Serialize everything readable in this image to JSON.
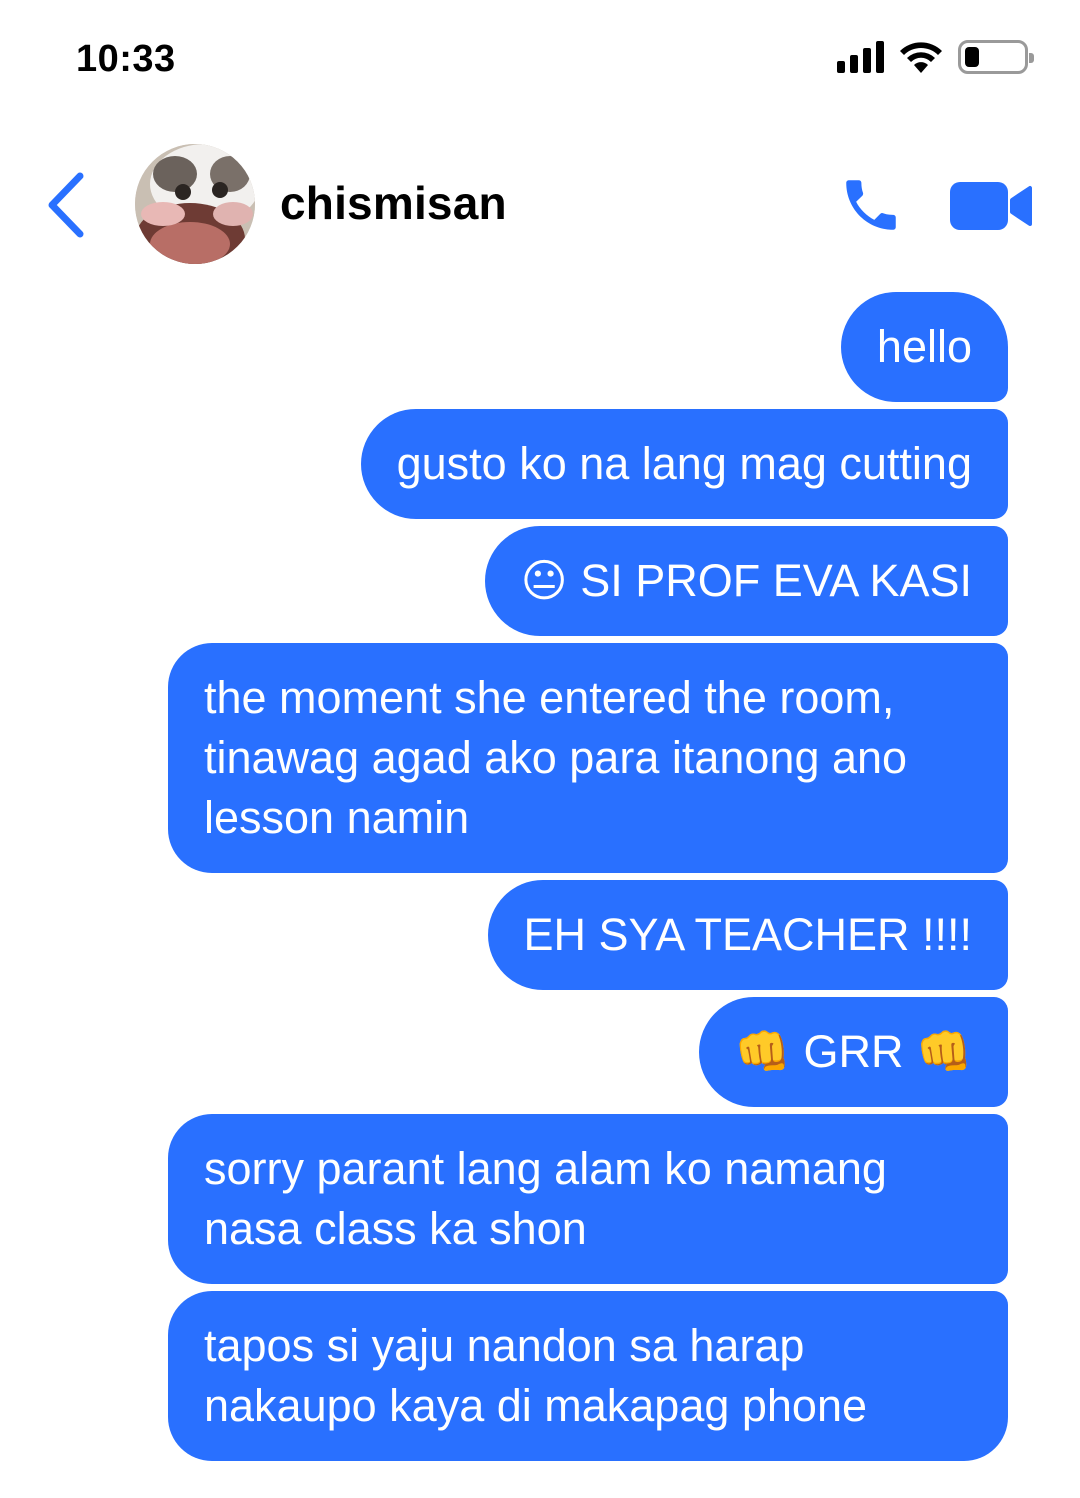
{
  "status_bar": {
    "time": "10:33",
    "signal_icon": "cellular-signal-icon",
    "wifi_icon": "wifi-icon",
    "battery_icon": "battery-low-icon",
    "battery_level": 0.25
  },
  "header": {
    "back_icon": "chevron-left-icon",
    "avatar_desc": "cat-photo-avatar",
    "title": "chismisan",
    "call_icon": "phone-icon",
    "video_icon": "video-camera-icon",
    "accent_color": "#2970ff"
  },
  "messages": [
    {
      "text": "hello"
    },
    {
      "text": "gusto ko na lang mag cutting"
    },
    {
      "text": "😐 SI PROF EVA KASI"
    },
    {
      "text": "the moment she entered the room, tinawag agad ako para itanong ano lesson namin"
    },
    {
      "text": "EH SYA TEACHER !!!!"
    },
    {
      "text": "👊 GRR 👊"
    },
    {
      "text": "sorry parant lang alam ko namang nasa class ka shon"
    },
    {
      "text": "tapos si yaju nandon sa harap nakaupo kaya di makapag phone"
    }
  ]
}
